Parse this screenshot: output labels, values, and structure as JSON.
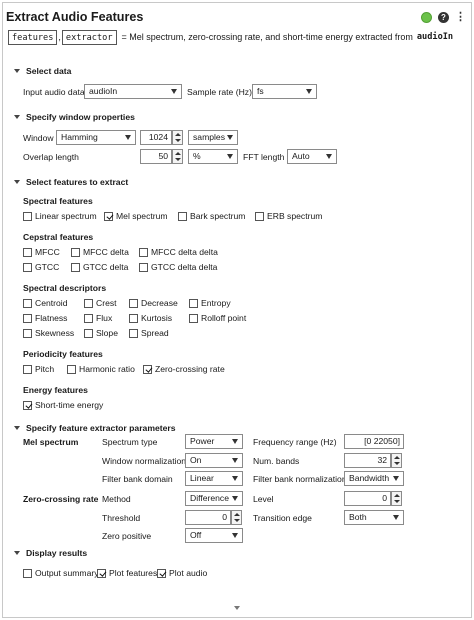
{
  "header": {
    "title": "Extract Audio Features",
    "code_var1": "features",
    "code_var2": "extractor",
    "code_desc": "= Mel spectrum, zero-crossing rate, and short-time energy extracted from",
    "code_input": "audioIn",
    "status_color": "#6cc24a"
  },
  "select_data": {
    "title": "Select data",
    "input_label": "Input audio data",
    "input_value": "audioIn",
    "rate_label": "Sample rate (Hz)",
    "rate_value": "fs"
  },
  "window": {
    "title": "Specify window properties",
    "window_label": "Window",
    "window_value": "Hamming",
    "length_value": "1024",
    "length_unit": "samples",
    "overlap_label": "Overlap length",
    "overlap_value": "50",
    "overlap_unit": "%",
    "fft_label": "FFT length",
    "fft_value": "Auto"
  },
  "features": {
    "title": "Select features to extract",
    "spectral": {
      "title": "Spectral features",
      "items": [
        {
          "label": "Linear spectrum",
          "checked": false
        },
        {
          "label": "Mel spectrum",
          "checked": true
        },
        {
          "label": "Bark spectrum",
          "checked": false
        },
        {
          "label": "ERB spectrum",
          "checked": false
        }
      ]
    },
    "cepstral": {
      "title": "Cepstral features",
      "items": [
        {
          "label": "MFCC",
          "checked": false
        },
        {
          "label": "MFCC delta",
          "checked": false
        },
        {
          "label": "MFCC delta delta",
          "checked": false
        },
        {
          "label": "GTCC",
          "checked": false
        },
        {
          "label": "GTCC delta",
          "checked": false
        },
        {
          "label": "GTCC delta delta",
          "checked": false
        }
      ]
    },
    "descriptors": {
      "title": "Spectral descriptors",
      "items": [
        {
          "label": "Centroid",
          "checked": false
        },
        {
          "label": "Crest",
          "checked": false
        },
        {
          "label": "Decrease",
          "checked": false
        },
        {
          "label": "Entropy",
          "checked": false
        },
        {
          "label": "Flatness",
          "checked": false
        },
        {
          "label": "Flux",
          "checked": false
        },
        {
          "label": "Kurtosis",
          "checked": false
        },
        {
          "label": "Rolloff point",
          "checked": false
        },
        {
          "label": "Skewness",
          "checked": false
        },
        {
          "label": "Slope",
          "checked": false
        },
        {
          "label": "Spread",
          "checked": false
        }
      ]
    },
    "periodicity": {
      "title": "Periodicity features",
      "items": [
        {
          "label": "Pitch",
          "checked": false
        },
        {
          "label": "Harmonic ratio",
          "checked": false
        },
        {
          "label": "Zero-crossing rate",
          "checked": true
        }
      ]
    },
    "energy": {
      "title": "Energy features",
      "items": [
        {
          "label": "Short-time energy",
          "checked": true
        }
      ]
    }
  },
  "params": {
    "title": "Specify feature extractor parameters",
    "mel": {
      "title": "Mel spectrum",
      "spectrum_type_label": "Spectrum type",
      "spectrum_type_value": "Power",
      "win_norm_label": "Window normalization",
      "win_norm_value": "On",
      "fb_domain_label": "Filter bank domain",
      "fb_domain_value": "Linear",
      "freq_range_label": "Frequency range (Hz)",
      "freq_range_value": "[0 22050]",
      "num_bands_label": "Num. bands",
      "num_bands_value": "32",
      "fb_norm_label": "Filter bank normalization",
      "fb_norm_value": "Bandwidth"
    },
    "zcr": {
      "title": "Zero-crossing rate",
      "method_label": "Method",
      "method_value": "Difference",
      "level_label": "Level",
      "level_value": "0",
      "threshold_label": "Threshold",
      "threshold_value": "0",
      "edge_label": "Transition edge",
      "edge_value": "Both",
      "zero_pos_label": "Zero positive",
      "zero_pos_value": "Off"
    }
  },
  "display": {
    "title": "Display results",
    "items": [
      {
        "label": "Output summary",
        "checked": false
      },
      {
        "label": "Plot features",
        "checked": true
      },
      {
        "label": "Plot audio",
        "checked": true
      }
    ]
  }
}
